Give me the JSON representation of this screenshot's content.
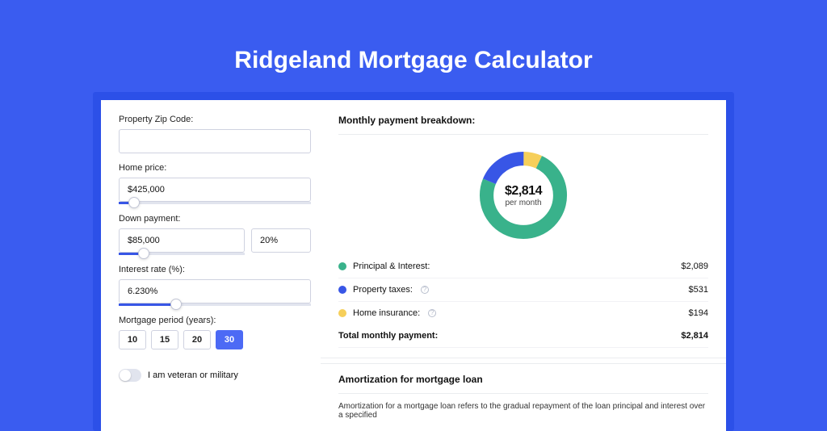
{
  "title": "Ridgeland Mortgage Calculator",
  "left": {
    "zip_label": "Property Zip Code:",
    "zip_value": "",
    "price_label": "Home price:",
    "price_value": "$425,000",
    "down_label": "Down payment:",
    "down_value": "$85,000",
    "down_pct": "20%",
    "rate_label": "Interest rate (%):",
    "rate_value": "6.230%",
    "period_label": "Mortgage period (years):",
    "periods": [
      "10",
      "15",
      "20",
      "30"
    ],
    "veteran_label": "I am veteran or military"
  },
  "right": {
    "breakdown_title": "Monthly payment breakdown:",
    "total": "$2,814",
    "sub": "per month",
    "legend": [
      {
        "key": "pi",
        "label": "Principal & Interest:",
        "value": "$2,089",
        "color": "#39b28b",
        "help": false
      },
      {
        "key": "tax",
        "label": "Property taxes:",
        "value": "$531",
        "color": "#3856e6",
        "help": true
      },
      {
        "key": "ins",
        "label": "Home insurance:",
        "value": "$194",
        "color": "#f6cf5a",
        "help": true
      }
    ],
    "total_row": {
      "label": "Total monthly payment:",
      "value": "$2,814"
    },
    "amort_title": "Amortization for mortgage loan",
    "amort_body": "Amortization for a mortgage loan refers to the gradual repayment of the loan principal and interest over a specified"
  },
  "chart_data": {
    "type": "pie",
    "title": "Monthly payment breakdown",
    "series": [
      {
        "name": "Principal & Interest",
        "value": 2089,
        "color": "#39b28b"
      },
      {
        "name": "Property taxes",
        "value": 531,
        "color": "#3856e6"
      },
      {
        "name": "Home insurance",
        "value": 194,
        "color": "#f6cf5a"
      }
    ],
    "total": 2814,
    "center_label": "$2,814",
    "center_sub": "per month"
  },
  "sliders": {
    "price_fill_pct": 8,
    "down_fill_pct": 20,
    "rate_fill_pct": 30
  }
}
